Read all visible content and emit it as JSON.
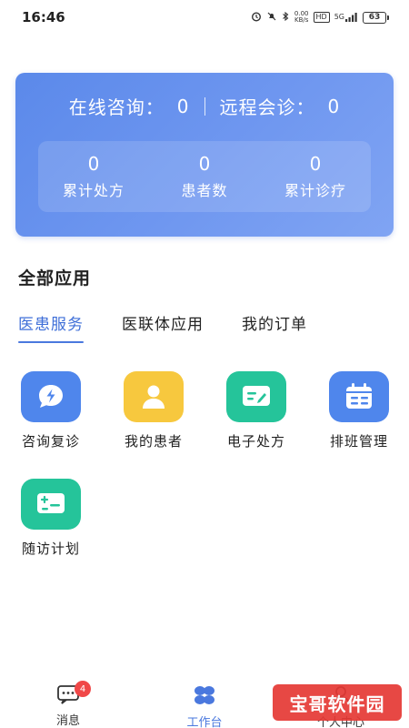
{
  "status_bar": {
    "time": "16:46",
    "net_speed_value": "0.00",
    "net_speed_unit": "KB/s",
    "hd": "HD",
    "network": "5G",
    "battery": "63"
  },
  "stats": {
    "online_label": "在线咨询：",
    "online_value": "0",
    "remote_label": "远程会诊：",
    "remote_value": "0",
    "items": [
      {
        "value": "0",
        "label": "累计处方"
      },
      {
        "value": "0",
        "label": "患者数"
      },
      {
        "value": "0",
        "label": "累计诊疗"
      }
    ]
  },
  "section_title": "全部应用",
  "tabs": [
    {
      "label": "医患服务"
    },
    {
      "label": "医联体应用"
    },
    {
      "label": "我的订单"
    }
  ],
  "apps": [
    {
      "label": "咨询复诊",
      "icon": "chat-bolt-icon",
      "color": "#4f86ec"
    },
    {
      "label": "我的患者",
      "icon": "person-icon",
      "color": "#f7c83e"
    },
    {
      "label": "电子处方",
      "icon": "prescription-icon",
      "color": "#25c49a"
    },
    {
      "label": "排班管理",
      "icon": "calendar-icon",
      "color": "#4f86ec"
    },
    {
      "label": "随访计划",
      "icon": "followup-icon",
      "color": "#25c49a"
    }
  ],
  "bottom_nav": [
    {
      "label": "消息",
      "icon": "message-icon",
      "badge": "4"
    },
    {
      "label": "工作台",
      "icon": "workbench-icon"
    },
    {
      "label": "个人中心",
      "icon": "person-outline-icon"
    }
  ],
  "colors": {
    "accent": "#4a78de",
    "card_gradient_start": "#5b89ea",
    "card_gradient_end": "#80a4f3",
    "badge": "#f04848"
  },
  "watermark": "宝哥软件园"
}
